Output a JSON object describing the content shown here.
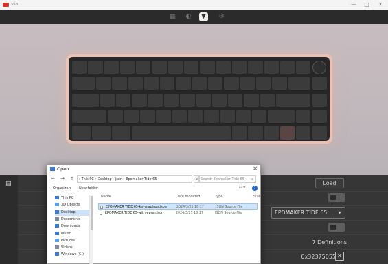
{
  "app": {
    "title": "via",
    "window_controls": [
      "—",
      "□",
      "✕"
    ]
  },
  "toolbar": {
    "tools": [
      {
        "name": "keyboard-icon",
        "glyph": "▦",
        "active": false
      },
      {
        "name": "brush-icon",
        "glyph": "◐",
        "active": false
      },
      {
        "name": "design-icon",
        "glyph": "▼",
        "active": true
      },
      {
        "name": "gear-icon",
        "glyph": "⚙",
        "active": false
      }
    ]
  },
  "panel": {
    "load_label": "Load",
    "keyboard_select": "EPOMAKER TIDE 65",
    "select_arrow": "▾",
    "definitions": "7 Definitions",
    "vid_pid": "0x32375055",
    "remove_glyph": "✕"
  },
  "dialog": {
    "title": "Open",
    "close_glyph": "✕",
    "nav_arrows": "← → ↑",
    "address": "› This PC › Desktop › json › Epomaker Tide 65",
    "refresh_glyph": "↻",
    "search_placeholder": "Search Epomaker Tide 65",
    "commands": {
      "organize": "Organize ▾",
      "new_folder": "New folder"
    },
    "view_glyph": "☷ ▾",
    "help_glyph": "?",
    "nav_items": [
      {
        "label": "This PC",
        "icon_color": "#3b7bd6"
      },
      {
        "label": "3D Objects",
        "icon_color": "#5aa0e6"
      },
      {
        "label": "Desktop",
        "icon_color": "#3b7bd6",
        "selected": true
      },
      {
        "label": "Documents",
        "icon_color": "#7d8a99"
      },
      {
        "label": "Downloads",
        "icon_color": "#3b7bd6"
      },
      {
        "label": "Music",
        "icon_color": "#3b7bd6"
      },
      {
        "label": "Pictures",
        "icon_color": "#5aa0e6"
      },
      {
        "label": "Videos",
        "icon_color": "#7d8a99"
      },
      {
        "label": "Windows (C:)",
        "icon_color": "#3b7bd6"
      }
    ],
    "columns": [
      "Name",
      "Date modified",
      "Type",
      "Size"
    ],
    "files": [
      {
        "name": "EPOMAKER TIDE 65-keymapjson.json",
        "date": "2024/3/21 18:17",
        "type": "JSON Source File",
        "selected": true
      },
      {
        "name": "EPOMAKER TIDE 65-with-epres.json",
        "date": "2024/3/21 18:17",
        "type": "JSON Source File",
        "selected": false
      }
    ]
  }
}
